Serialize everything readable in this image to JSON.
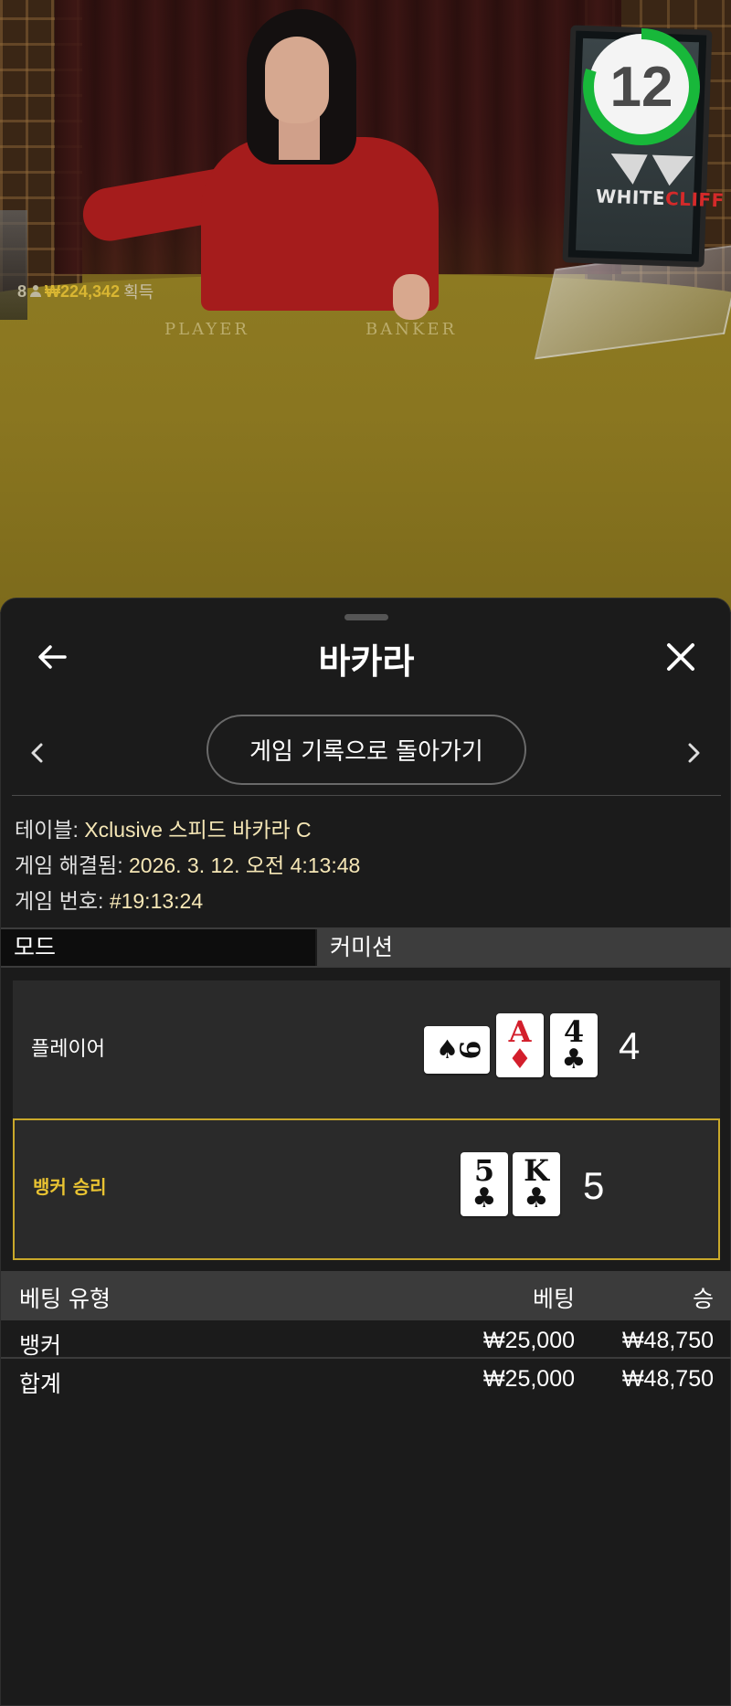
{
  "video": {
    "timer_value": "12",
    "timer_progress": 0.8,
    "brand": {
      "part1": "WHITE",
      "part2": "CLIFF"
    },
    "felt_labels": {
      "player": "PLAYER",
      "banker": "BANKER"
    },
    "winnings": {
      "player_count": "8",
      "amount": "₩224,342",
      "suffix": "획득"
    }
  },
  "panel": {
    "title": "바카라",
    "return_button": "게임 기록으로 돌아가기",
    "info": {
      "table_label": "테이블:",
      "table_value": "Xclusive 스피드 바카라 C",
      "resolved_label": "게임 해결됨:",
      "resolved_value": "2026. 3. 12. 오전 4:13:48",
      "game_no_label": "게임 번호:",
      "game_no_value": "#19:13:24"
    },
    "mode": {
      "label": "모드",
      "value": "커미션"
    },
    "player_hand": {
      "label": "플레이어",
      "score": "4",
      "cards": [
        {
          "rank": "9",
          "suit": "♠",
          "color": "black",
          "sideways": true
        },
        {
          "rank": "A",
          "suit": "♦",
          "color": "red",
          "sideways": false
        },
        {
          "rank": "4",
          "suit": "♣",
          "color": "black",
          "sideways": false
        }
      ]
    },
    "banker_hand": {
      "label": "뱅커 승리",
      "score": "5",
      "cards": [
        {
          "rank": "5",
          "suit": "♣",
          "color": "black",
          "sideways": false
        },
        {
          "rank": "K",
          "suit": "♣",
          "color": "black",
          "sideways": false
        }
      ]
    },
    "bets": {
      "headers": {
        "type": "베팅 유형",
        "bet": "베팅",
        "win": "승"
      },
      "rows": [
        {
          "type": "뱅커",
          "bet": "₩25,000",
          "win": "₩48,750"
        }
      ],
      "total": {
        "type": "합계",
        "bet": "₩25,000",
        "win": "₩48,750"
      }
    }
  },
  "colors": {
    "accent_gold": "#c9a82a",
    "value_text": "#f6e7b6",
    "timer_green": "#18b83a"
  }
}
